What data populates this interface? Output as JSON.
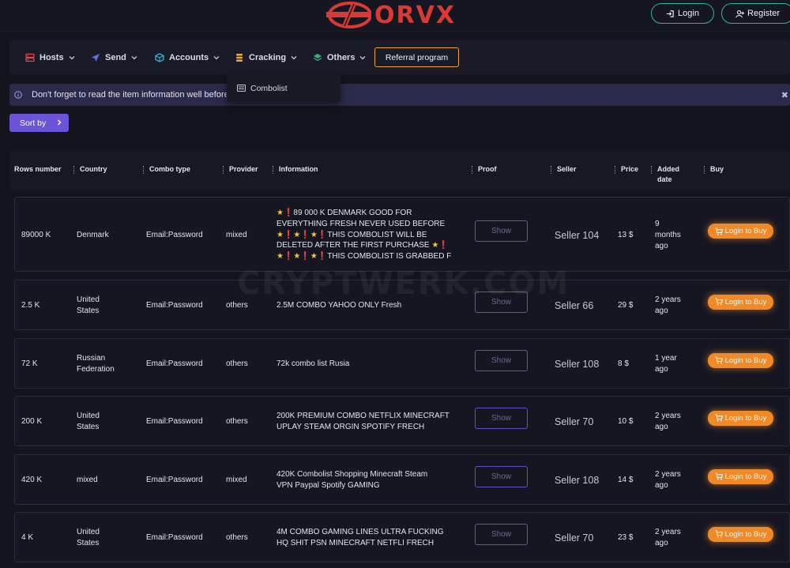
{
  "header": {
    "logo_text": "ORVX",
    "login_label": "Login",
    "register_label": "Register",
    "accent": "#2fb48f",
    "brand_color": "#d93a33"
  },
  "nav": {
    "items": [
      {
        "label": "Hosts",
        "icon": "server-icon"
      },
      {
        "label": "Send",
        "icon": "paper-plane-icon"
      },
      {
        "label": "Accounts",
        "icon": "cube-icon"
      },
      {
        "label": "Cracking",
        "icon": "stack-icon"
      },
      {
        "label": "Others",
        "icon": "layers-icon"
      }
    ],
    "referral_label": "Referral program",
    "dropdown_item": "Combolist"
  },
  "notice": {
    "text": "Don't forget to read the item information well before"
  },
  "sort": {
    "label": "Sort by"
  },
  "table": {
    "headers": [
      "Rows number",
      "Country",
      "Combo type",
      "Provider",
      "Information",
      "Proof",
      "Seller",
      "Price",
      "Added date",
      "Buy"
    ],
    "show_label": "Show",
    "buy_label": "Login to Buy",
    "rows": [
      {
        "rows": "89000 K",
        "country": "Denmark",
        "combo": "Email:Password",
        "provider": "mixed",
        "info_lines": [
          [
            {
              "t": "★",
              "c": "star"
            },
            {
              "t": "❗",
              "c": "bang"
            },
            {
              "t": "89 000 K DENMARK GOOD FOR"
            }
          ],
          [
            {
              "t": "EVERYTHING FRESH NEVER USED BEFORE"
            }
          ],
          [
            {
              "t": "★",
              "c": "star"
            },
            {
              "t": "❗",
              "c": "bang"
            },
            {
              "t": "★",
              "c": "star"
            },
            {
              "t": "❗",
              "c": "bang"
            },
            {
              "t": "★",
              "c": "star"
            },
            {
              "t": "❗",
              "c": "bang"
            },
            {
              "t": "THIS COMBOLIST WILL BE"
            }
          ],
          [
            {
              "t": "DELETED AFTER THE FIRST PURCHASE "
            },
            {
              "t": "★",
              "c": "star"
            },
            {
              "t": "❗",
              "c": "bang"
            }
          ],
          [
            {
              "t": "★",
              "c": "star"
            },
            {
              "t": "❗",
              "c": "bang"
            },
            {
              "t": "★",
              "c": "star"
            },
            {
              "t": "❗",
              "c": "bang"
            },
            {
              "t": "★",
              "c": "star"
            },
            {
              "t": "❗",
              "c": "bang"
            },
            {
              "t": "THIS COMBOLIST IS GRABBED F"
            }
          ]
        ],
        "seller": "Seller 104",
        "price": "13 $",
        "date_lines": [
          "9",
          "months",
          "ago"
        ]
      },
      {
        "rows": "2.5 K",
        "country_lines": [
          "United",
          "States"
        ],
        "combo": "Email:Password",
        "provider": "others",
        "info_lines": [
          [
            {
              "t": "2.5M COMBO YAHOO ONLY Fresh"
            }
          ]
        ],
        "seller": "Seller 66",
        "price": "29 $",
        "date_lines": [
          "2 years",
          "ago"
        ]
      },
      {
        "rows": "72 K",
        "country_lines": [
          "Russian",
          "Federation"
        ],
        "combo": "Email:Password",
        "provider": "others",
        "info_lines": [
          [
            {
              "t": "72k combo list Rusia"
            }
          ]
        ],
        "seller": "Seller 108",
        "price": "8 $",
        "date_lines": [
          "1 year",
          "ago"
        ]
      },
      {
        "rows": "200 K",
        "country_lines": [
          "United",
          "States"
        ],
        "combo": "Email:Password",
        "provider": "others",
        "info_lines": [
          [
            {
              "t": "200K PREMIUM COMBO NETFLIX MINECRAFT"
            }
          ],
          [
            {
              "t": "UPLAY STEAM ORGIN SPOTIFY FRECH"
            }
          ]
        ],
        "seller": "Seller 70",
        "price": "10 $",
        "date_lines": [
          "2 years",
          "ago"
        ]
      },
      {
        "rows": "420 K",
        "country": "mixed",
        "combo": "Email:Password",
        "provider": "mixed",
        "info_lines": [
          [
            {
              "t": "420K Combolist Shopping Minecraft Steam"
            }
          ],
          [
            {
              "t": "VPN Paypal Spotify GAMING"
            }
          ]
        ],
        "seller": "Seller 108",
        "price": "14 $",
        "date_lines": [
          "2 years",
          "ago"
        ]
      },
      {
        "rows": "4 K",
        "country_lines": [
          "United",
          "States"
        ],
        "combo": "Email:Password",
        "provider": "others",
        "info_lines": [
          [
            {
              "t": "4M COMBO GAMING LINES ULTRA FUCKING"
            }
          ],
          [
            {
              "t": "HQ SHIT PSN MINECRAFT NETFLI FRECH"
            }
          ]
        ],
        "seller": "Seller 70",
        "price": "23 $",
        "date_lines": [
          "2 years",
          "ago"
        ]
      }
    ]
  },
  "watermark": "CRYPTWERK.COM"
}
